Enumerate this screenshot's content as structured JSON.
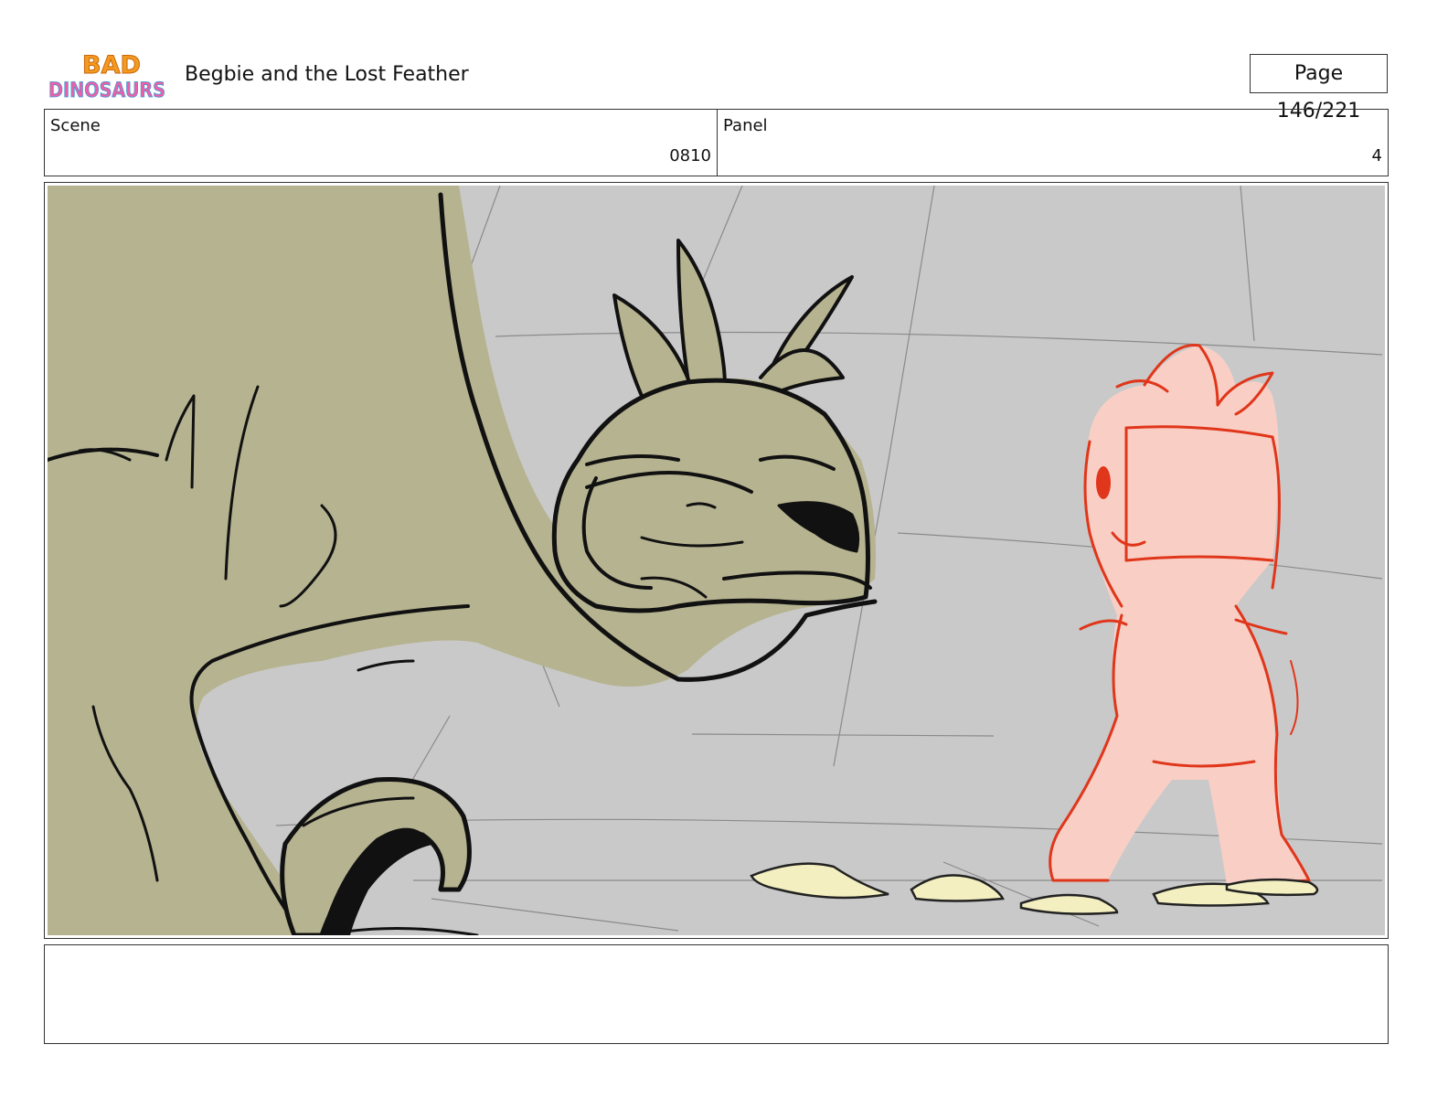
{
  "header": {
    "logo_text_top": "BAD",
    "logo_text_bottom": "DINOSAURS",
    "title": "Begbie and the Lost Feather",
    "page_label": "Page 146/221"
  },
  "info": {
    "scene_label": "Scene",
    "scene_value": "0810",
    "panel_label": "Panel",
    "panel_value": "4"
  },
  "panel_image": {
    "background_color": "#c9c9c9",
    "big_dino_color": "#b6b390",
    "small_dino_color": "#f9cfc5",
    "small_dino_line": "#e0361b",
    "feather_color": "#f4efc0"
  },
  "notes": {
    "text": ""
  }
}
